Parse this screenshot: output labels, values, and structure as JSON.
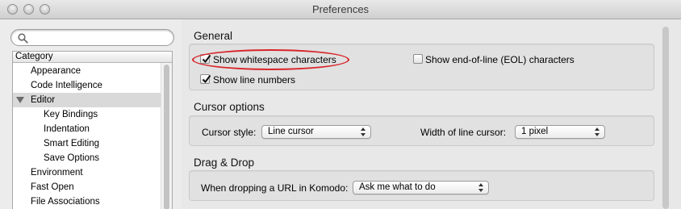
{
  "window": {
    "title": "Preferences"
  },
  "search": {
    "placeholder": "",
    "value": ""
  },
  "sidebar": {
    "header": "Category",
    "items": [
      {
        "label": "Appearance",
        "level": 0
      },
      {
        "label": "Code Intelligence",
        "level": 0
      },
      {
        "label": "Editor",
        "level": 0,
        "expanded": true,
        "selected": true
      },
      {
        "label": "Key Bindings",
        "level": 1
      },
      {
        "label": "Indentation",
        "level": 1
      },
      {
        "label": "Smart Editing",
        "level": 1
      },
      {
        "label": "Save Options",
        "level": 1
      },
      {
        "label": "Environment",
        "level": 0
      },
      {
        "label": "Fast Open",
        "level": 0
      },
      {
        "label": "File Associations",
        "level": 0
      }
    ]
  },
  "general": {
    "heading": "General",
    "show_whitespace": {
      "label": "Show whitespace characters",
      "checked": true
    },
    "show_eol": {
      "label": "Show end-of-line (EOL) characters",
      "checked": false
    },
    "show_line_numbers": {
      "label": "Show line numbers",
      "checked": true
    }
  },
  "cursor": {
    "heading": "Cursor options",
    "style_label": "Cursor style:",
    "style_value": "Line cursor",
    "width_label": "Width of line cursor:",
    "width_value": "1 pixel"
  },
  "drag_drop": {
    "heading": "Drag & Drop",
    "url_label": "When dropping a URL in Komodo:",
    "url_value": "Ask me what to do"
  },
  "colors": {
    "highlight": "#d8252a",
    "selected_row": "#d9d9d9"
  }
}
